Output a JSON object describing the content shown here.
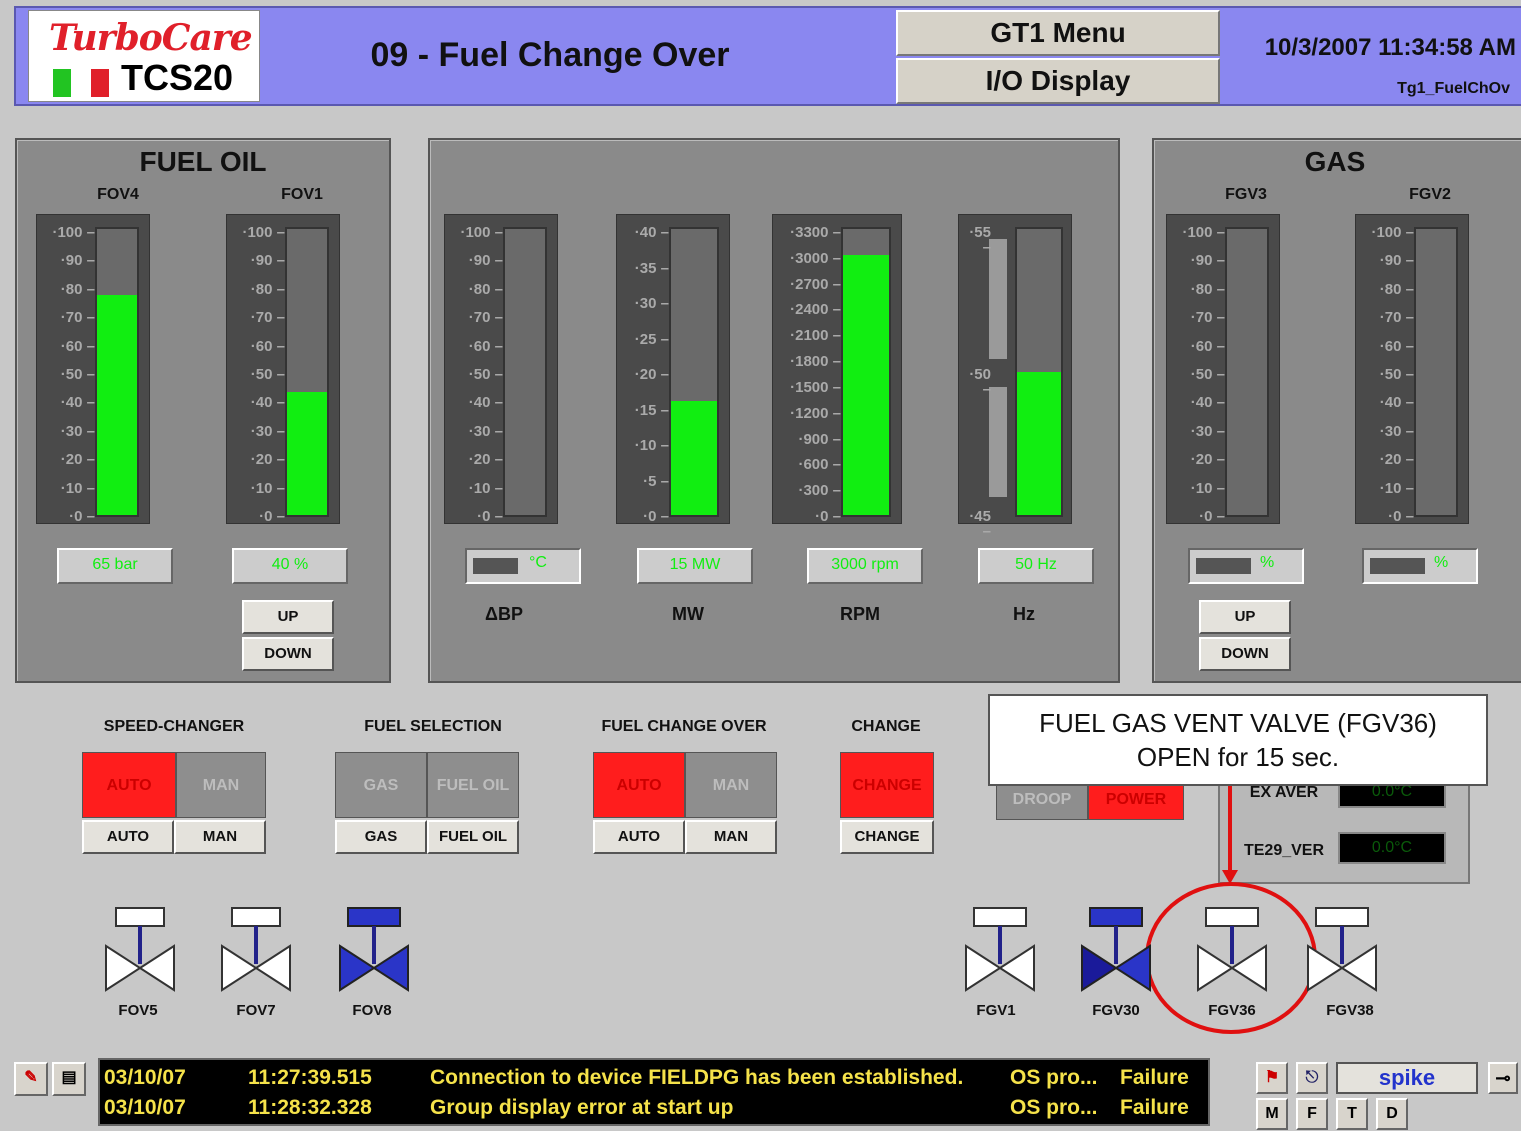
{
  "header": {
    "logo_turbocare": "TurboCare",
    "logo_tcs": "TCS20",
    "title": "09 - Fuel Change Over",
    "menu_btn": "GT1 Menu",
    "io_btn": "I/O Display",
    "datetime": "10/3/2007 11:34:58 AM",
    "display_name": "Tg1_FuelChOv"
  },
  "fuel_oil": {
    "title": "FUEL OIL",
    "fov4": {
      "label": "FOV4",
      "value_pct": 0.77,
      "readout": "65 bar"
    },
    "fov1": {
      "label": "FOV1",
      "value_pct": 0.43,
      "readout": "40 %"
    },
    "up": "UP",
    "down": "DOWN"
  },
  "scale_100": [
    "100",
    "90",
    "80",
    "70",
    "60",
    "50",
    "40",
    "30",
    "20",
    "10",
    "0"
  ],
  "middle": {
    "dbp": {
      "label": "ΔBP",
      "unit": "°C",
      "value_pct": 0,
      "mini_pct": 0.45
    },
    "mw": {
      "label": "MW",
      "ticks": [
        "40",
        "35",
        "30",
        "25",
        "20",
        "15",
        "10",
        "5",
        "0"
      ],
      "value_pct": 0.4,
      "readout": "15 MW"
    },
    "rpm": {
      "label": "RPM",
      "ticks": [
        "3300",
        "3000",
        "2700",
        "2400",
        "2100",
        "1800",
        "1500",
        "1200",
        "900",
        "600",
        "300",
        "0"
      ],
      "value_pct": 0.91,
      "readout": "3000 rpm"
    },
    "hz": {
      "label": "Hz",
      "ticks": [
        "55",
        "50",
        "45"
      ],
      "value_pct": 0.5,
      "readout": "50 Hz"
    }
  },
  "gas": {
    "title": "GAS",
    "fgv3": {
      "label": "FGV3",
      "mini_pct": 0.55,
      "unit": "%"
    },
    "fgv2": {
      "label": "FGV2",
      "mini_pct": 0.55,
      "unit": "%"
    },
    "up": "UP",
    "down": "DOWN"
  },
  "controls": {
    "speed_changer": {
      "label": "SPEED-CHANGER",
      "ind_a": "AUTO",
      "ind_b": "MAN",
      "btn_a": "AUTO",
      "btn_b": "MAN"
    },
    "fuel_selection": {
      "label": "FUEL SELECTION",
      "ind_a": "GAS",
      "ind_b": "FUEL OIL",
      "btn_a": "GAS",
      "btn_b": "FUEL OIL"
    },
    "fuel_change_over": {
      "label": "FUEL CHANGE OVER",
      "ind_a": "AUTO",
      "ind_b": "MAN",
      "btn_a": "AUTO",
      "btn_b": "MAN"
    },
    "change": {
      "label": "CHANGE",
      "ind": "CHANGE",
      "btn": "CHANGE"
    },
    "droop": "DROOP",
    "power": "POWER",
    "ex_aver": {
      "label": "EX AVER",
      "value": "0.0°C"
    },
    "te29": {
      "label": "TE29_VER",
      "value": "0.0°C"
    }
  },
  "callout": {
    "line1": "FUEL GAS VENT VALVE (FGV36)",
    "line2": "OPEN for 15 sec."
  },
  "valves": {
    "fov5": "FOV5",
    "fov7": "FOV7",
    "fov8": "FOV8",
    "fgv1": "FGV1",
    "fgv30": "FGV30",
    "fgv36": "FGV36",
    "fgv38": "FGV38"
  },
  "status": {
    "rows": [
      {
        "date": "03/10/07",
        "time": "11:27:39.515",
        "msg": "Connection to device FIELDPG has been established.",
        "src": "OS pro...",
        "state": "Failure"
      },
      {
        "date": "03/10/07",
        "time": "11:28:32.328",
        "msg": "Group display error at start up",
        "src": "OS pro...",
        "state": "Failure"
      }
    ]
  },
  "toolbar": {
    "user": "spike",
    "m": "M",
    "f": "F",
    "t": "T",
    "d": "D"
  },
  "colors": {
    "green": "#11ee11",
    "red": "#ff1d1d",
    "blue": "#2a35c8",
    "header": "#8a87f0",
    "status_text": "#f5e24a"
  }
}
